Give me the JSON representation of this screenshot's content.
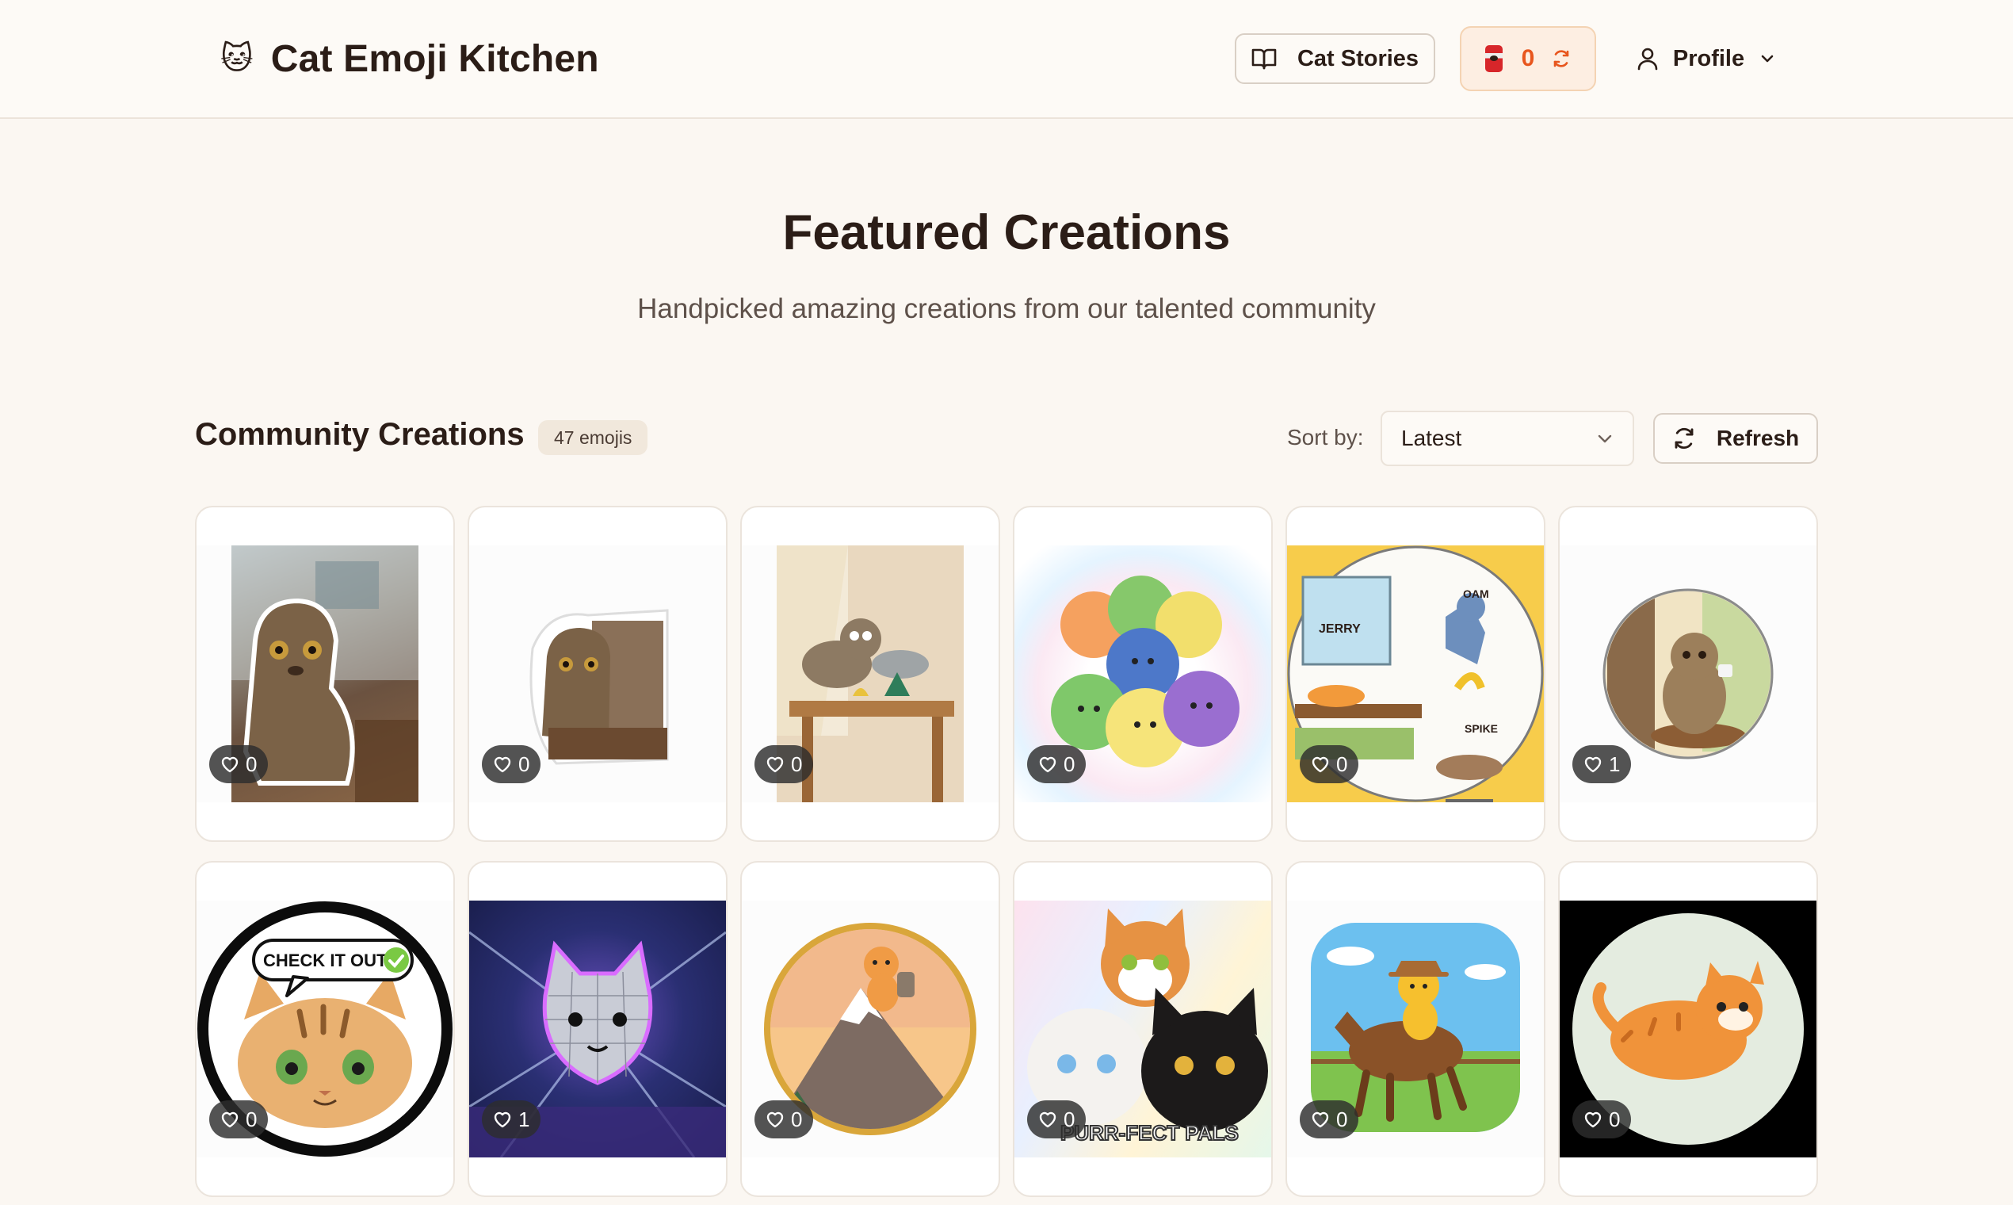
{
  "header": {
    "brand_icon": "🐱",
    "brand_title": "Cat Emoji Kitchen",
    "stories_label": "Cat Stories",
    "cans_count": "0",
    "profile_label": "Profile"
  },
  "hero": {
    "title": "Featured Creations",
    "subtitle": "Handpicked amazing creations from our talented community"
  },
  "toolbar": {
    "section_title": "Community Creations",
    "count_badge": "47 emojis",
    "sort_label": "Sort by:",
    "sort_value": "Latest",
    "refresh_label": "Refresh"
  },
  "cards": [
    {
      "likes": "0",
      "art": "photo-cat-cutout"
    },
    {
      "likes": "0",
      "art": "photo-cat-sticker"
    },
    {
      "likes": "0",
      "art": "cartoon-cats-table"
    },
    {
      "likes": "0",
      "art": "rainbow-cat-pile"
    },
    {
      "likes": "0",
      "art": "tom-and-jerry-scene"
    },
    {
      "likes": "1",
      "art": "cat-coffee-window"
    },
    {
      "likes": "0",
      "art": "check-it-out-cat"
    },
    {
      "likes": "1",
      "art": "disco-ball-cat"
    },
    {
      "likes": "0",
      "art": "mountain-climber-cat"
    },
    {
      "likes": "0",
      "art": "purr-fect-pals"
    },
    {
      "likes": "0",
      "art": "cowboy-cat-horse"
    },
    {
      "likes": "0",
      "art": "flying-orange-cat"
    }
  ],
  "art_text": {
    "jerry": "JERRY",
    "spike": "SPIKE",
    "oam": "OAM",
    "check_it_out": "CHECK IT OUT",
    "purr_fect_pals": "PURR-FECT PALS"
  },
  "colors": {
    "background": "#fbf7f2",
    "accent_orange": "#e8561e",
    "text_primary": "#2b1d17"
  }
}
